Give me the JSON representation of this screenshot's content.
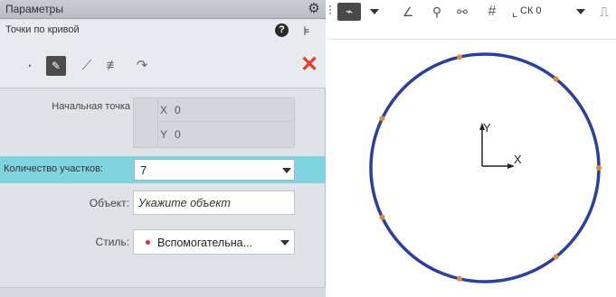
{
  "panel": {
    "title": "Параметры",
    "command_title": "Точки по кривой",
    "modes": [
      {
        "name": "point",
        "icon": "•"
      },
      {
        "name": "points-on-curve",
        "icon": "✎"
      },
      {
        "name": "intersection",
        "icon": "⟋"
      },
      {
        "name": "hatch",
        "icon": "≢"
      },
      {
        "name": "arc",
        "icon": "↷"
      }
    ],
    "start_point": {
      "label": "Начальная точка",
      "x_label": "X",
      "x_value": "0",
      "y_label": "Y",
      "y_value": "0"
    },
    "segments": {
      "label": "Количество участков:",
      "value": "7"
    },
    "object": {
      "label": "Объект:",
      "value": "Укажите объект"
    },
    "style": {
      "label": "Стиль:",
      "value": "Вспомогательна...",
      "dot_color": "#e0303a"
    }
  },
  "toolbar": {
    "cs_label": "СК 0"
  },
  "canvas": {
    "axis_x_label": "X",
    "axis_y_label": "Y",
    "circle_color": "#2a3f9e",
    "point_color": "#e08a3a",
    "segment_count": 7
  },
  "colors": {
    "highlight": "#80d4e0",
    "close": "#e0402a"
  }
}
